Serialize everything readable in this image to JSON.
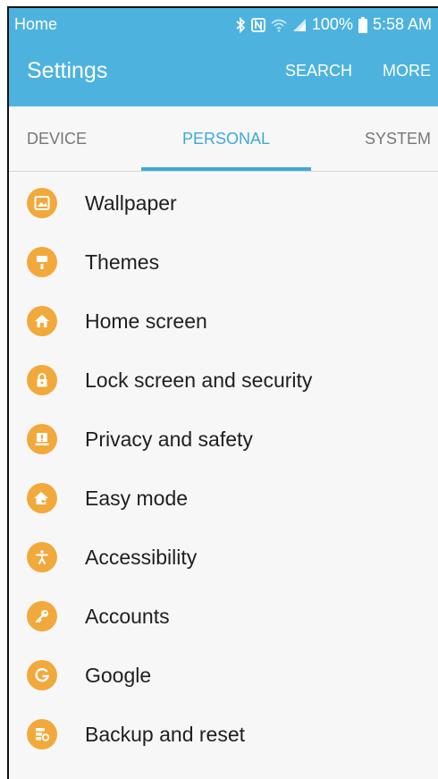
{
  "status_bar": {
    "left_label": "Home",
    "battery": "100%",
    "time": "5:58 AM",
    "icons": [
      "bluetooth-icon",
      "nfc-icon",
      "wifi-icon",
      "signal-icon",
      "battery-icon"
    ]
  },
  "app_bar": {
    "title": "Settings",
    "search_label": "SEARCH",
    "more_label": "MORE"
  },
  "tabs": [
    {
      "label": "DEVICE",
      "active": false
    },
    {
      "label": "PERSONAL",
      "active": true
    },
    {
      "label": "SYSTEM",
      "active": false
    }
  ],
  "items": [
    {
      "label": "Wallpaper",
      "icon": "wallpaper-icon"
    },
    {
      "label": "Themes",
      "icon": "themes-icon"
    },
    {
      "label": "Home screen",
      "icon": "home-icon"
    },
    {
      "label": "Lock screen and security",
      "icon": "lock-icon"
    },
    {
      "label": "Privacy and safety",
      "icon": "privacy-icon"
    },
    {
      "label": "Easy mode",
      "icon": "easy-mode-icon"
    },
    {
      "label": "Accessibility",
      "icon": "accessibility-icon"
    },
    {
      "label": "Accounts",
      "icon": "key-icon"
    },
    {
      "label": "Google",
      "icon": "google-icon"
    },
    {
      "label": "Backup and reset",
      "icon": "backup-icon"
    }
  ],
  "colors": {
    "accent": "#4db3de",
    "tab_active": "#3ea9d6",
    "icon_background": "#f2a93b"
  }
}
